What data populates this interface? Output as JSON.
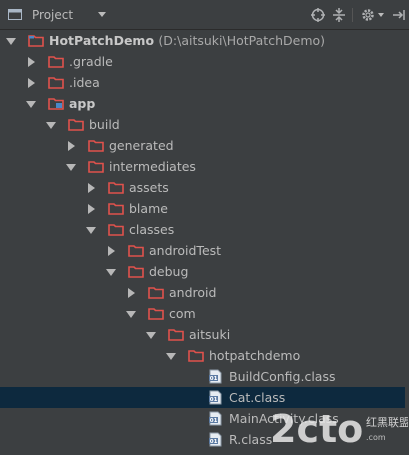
{
  "toolbar": {
    "title": "Project",
    "icons": [
      "project-icon",
      "dropdown-icon",
      "target-icon",
      "collapse-icon",
      "gear-icon",
      "hide-icon"
    ]
  },
  "tree": {
    "rows": [
      {
        "label": "HotPatchDemo",
        "path": "(D:\\aitsuki\\HotPatchDemo)",
        "type": "project",
        "expanded": true,
        "bold": true
      },
      {
        "label": ".gradle",
        "type": "folder",
        "expanded": false
      },
      {
        "label": ".idea",
        "type": "folder",
        "expanded": false
      },
      {
        "label": "app",
        "type": "module",
        "expanded": true,
        "bold": true
      },
      {
        "label": "build",
        "type": "folder",
        "expanded": true
      },
      {
        "label": "generated",
        "type": "folder",
        "expanded": false
      },
      {
        "label": "intermediates",
        "type": "folder",
        "expanded": true
      },
      {
        "label": "assets",
        "type": "folder",
        "expanded": false
      },
      {
        "label": "blame",
        "type": "folder",
        "expanded": false
      },
      {
        "label": "classes",
        "type": "folder",
        "expanded": true
      },
      {
        "label": "androidTest",
        "type": "folder",
        "expanded": false
      },
      {
        "label": "debug",
        "type": "folder",
        "expanded": true
      },
      {
        "label": "android",
        "type": "folder",
        "expanded": false
      },
      {
        "label": "com",
        "type": "folder",
        "expanded": true
      },
      {
        "label": "aitsuki",
        "type": "folder",
        "expanded": true
      },
      {
        "label": "hotpatchdemo",
        "type": "folder",
        "expanded": true
      },
      {
        "label": "BuildConfig.class",
        "type": "class"
      },
      {
        "label": "Cat.class",
        "type": "class",
        "selected": true
      },
      {
        "label": "MainActivity.class",
        "type": "class"
      },
      {
        "label": "R.class",
        "type": "class"
      }
    ]
  },
  "watermark": {
    "text": "2cto",
    "sub": "红黑联盟",
    "color": "#e8e8e8"
  },
  "colors": {
    "background": "#3c3f41",
    "selection": "#0d293e",
    "folder": "#e0524c",
    "text": "#bbbbbb"
  }
}
